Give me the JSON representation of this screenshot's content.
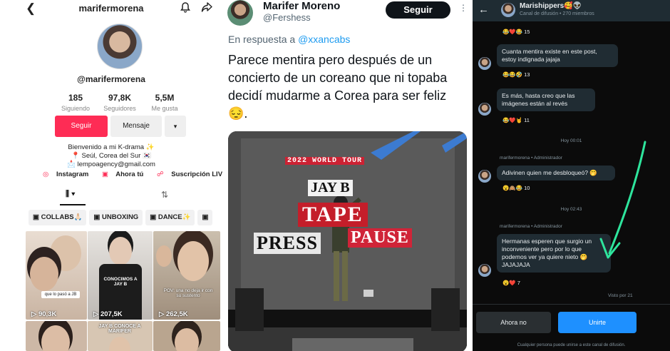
{
  "tiktok": {
    "username": "marifermorena",
    "handle": "@marifermorena",
    "stats": [
      {
        "value": "185",
        "label": "Siguiendo"
      },
      {
        "value": "97,8K",
        "label": "Seguidores"
      },
      {
        "value": "5,5M",
        "label": "Me gusta"
      }
    ],
    "follow_label": "Seguir",
    "message_label": "Mensaje",
    "more_label": "▾",
    "bio": [
      "Bienvenido a mi K-drama ✨",
      "📍 Seúl, Corea del Sur 🇰🇷",
      "📩 lempoagency@gmail.com"
    ],
    "links": [
      "Instagram",
      "Ahora tú",
      "Suscripción LIVE"
    ],
    "tab_videos": "⫼ ▾",
    "tab_reposts": "⇅",
    "chips": [
      "COLLABS🙏🏻",
      "UNBOXING",
      "DANCE✨",
      ""
    ],
    "videos": [
      {
        "views": "90,3K",
        "caption": "que lo pasó a JB"
      },
      {
        "views": "207,5K",
        "caption": "CONOCIMOS A JAY B"
      },
      {
        "views": "262,5K",
        "caption": "POV: una no deja ir con su sustento"
      },
      {
        "views": "",
        "caption": ""
      },
      {
        "views": "",
        "caption": "JAY B CONOCE A MARIFER"
      },
      {
        "views": "",
        "caption": ""
      }
    ]
  },
  "twitter": {
    "name": "Marifer Moreno",
    "handle": "@Fershess",
    "follow_label": "Seguir",
    "reply_prefix": "En respuesta a",
    "reply_to": "@xxancabs",
    "text": "Parece mentira pero después de un concierto de un coreano que ni topaba decidí mudarme a Corea para ser feliz 😔.",
    "image_text": {
      "line1": "2022 WORLD TOUR",
      "line2": "JAY B",
      "line3": "TAPE",
      "line4": "PRESS",
      "line5": "PAUSE"
    }
  },
  "whatsapp": {
    "title": "Marishippers🥰👽",
    "subtitle": "Canal de difusión • 270 miembros",
    "messages": [
      {
        "text": "",
        "reactions": "😂❤️😂 15"
      },
      {
        "text": "Cuanta mentira existe en este post, estoy indignada jajaja",
        "reactions": "😂😂🤣 13"
      },
      {
        "text": "Es más, hasta creo que las imágenes están al revés",
        "reactions": "😂❤️🤘 11"
      },
      {
        "text": "Adivinen quien me desbloqueó? 🤭",
        "reactions": "😮🙈😂 10"
      },
      {
        "text": "Hermanas esperen que surgio un inconveniente pero por lo que podemos ver ya quiere nieto 🤭 JAJAJAJA",
        "reactions": "😮❤️ 7"
      }
    ],
    "day_sep1": "Hoy 00:01",
    "day_sep2": "Hoy 02:43",
    "sender1": "marifermorena • Administrador",
    "sender2": "marifermorena • Administrador",
    "seen": "Visto por 21",
    "btn_no": "Ahora no",
    "btn_join": "Unirte",
    "footer": "Cualquier persona puede unirse a este canal de difusión."
  },
  "colors": {
    "tiktok_red": "#fe2c55",
    "twitter_blue": "#1d9bf0",
    "whatsapp_bg": "#0b0b0b",
    "join_blue": "#1e90ff",
    "arrow_green": "#2ee59d"
  }
}
